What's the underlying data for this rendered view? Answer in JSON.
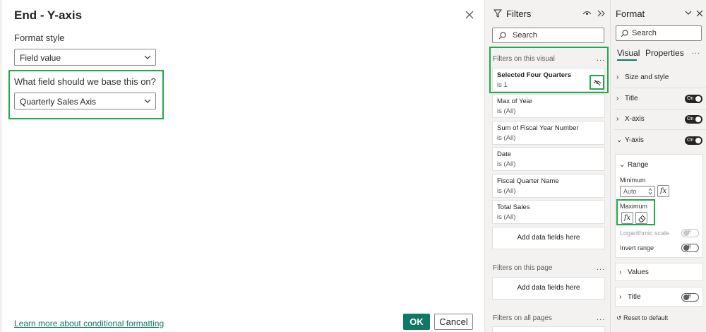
{
  "dialog": {
    "title": "End - Y-axis",
    "format_style_label": "Format style",
    "format_style_value": "Field value",
    "base_field_label": "What field should we base this on?",
    "base_field_value": "Quarterly Sales Axis",
    "learn_more_link": "Learn more about conditional formatting",
    "ok_label": "OK",
    "cancel_label": "Cancel"
  },
  "filters": {
    "title": "Filters",
    "search_placeholder": "Search",
    "on_visual_header": "Filters on this visual",
    "on_page_header": "Filters on this page",
    "on_all_pages_header": "Filters on all pages",
    "more": "...",
    "visual_filters": [
      {
        "name": "Selected Four Quarters",
        "value": "is 1"
      },
      {
        "name": "Max of Year",
        "value": "is (All)"
      },
      {
        "name": "Sum of Fiscal Year Number",
        "value": "is (All)"
      },
      {
        "name": "Date",
        "value": "is (All)"
      },
      {
        "name": "Fiscal Quarter Name",
        "value": "is (All)"
      },
      {
        "name": "Total Sales",
        "value": "is (All)"
      }
    ],
    "add_fields_label": "Add data fields here"
  },
  "format": {
    "title": "Format",
    "search_placeholder": "Search",
    "tab_visual": "Visual",
    "tab_properties": "Properties",
    "more": "...",
    "size_and_style": "Size and style",
    "title_row": "Title",
    "x_axis": "X-axis",
    "y_axis": "Y-axis",
    "toggle_on": "On",
    "toggle_off": "Off",
    "range_header": "Range",
    "minimum_label": "Minimum",
    "minimum_value": "Auto",
    "maximum_label": "Maximum",
    "fx_symbol": "fx",
    "log_scale_label": "Logarithmic scale",
    "invert_range_label": "Invert range",
    "values_row": "Values",
    "title_sub_row": "Title",
    "reset_label": "Reset to default"
  },
  "colors": {
    "accent": "#117865",
    "highlight": "#22a84a"
  }
}
